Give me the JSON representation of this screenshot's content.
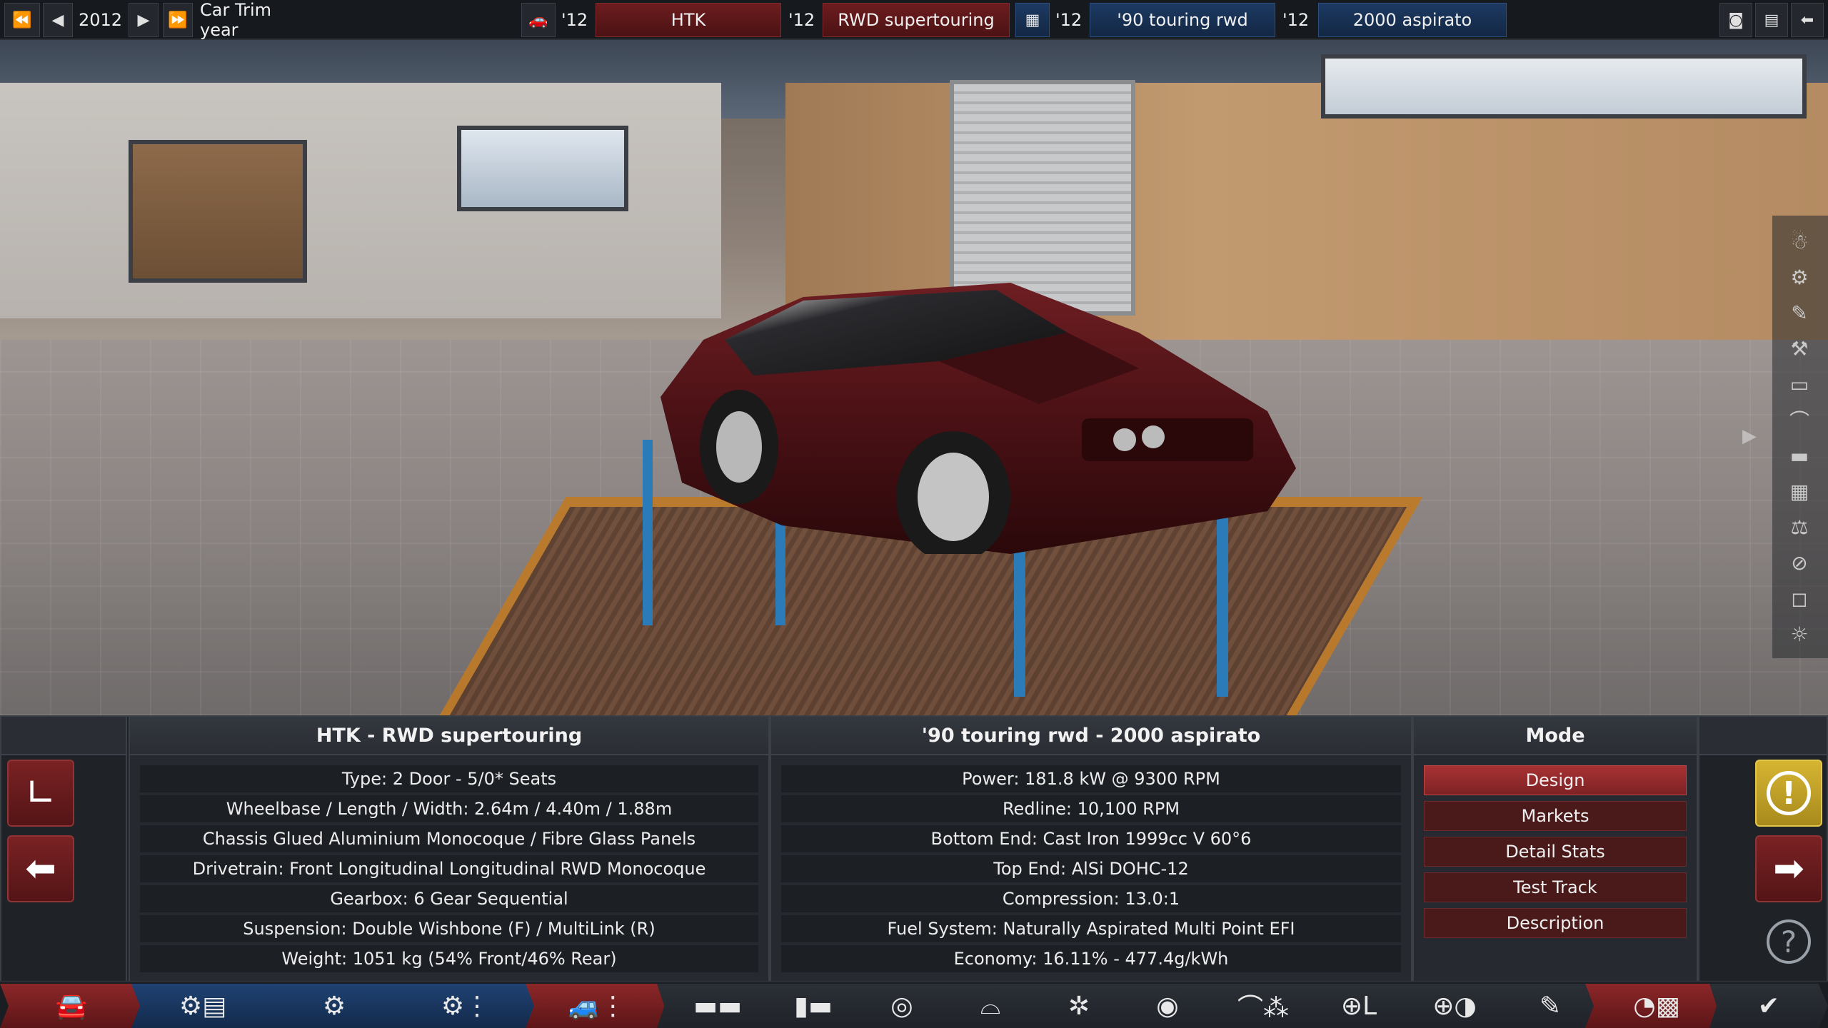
{
  "topbar": {
    "year": "2012",
    "year_label": "Car Trim year",
    "model_year": "'12",
    "model_name": "HTK",
    "trim_year": "'12",
    "trim_name": "RWD supertouring",
    "engine_family_year": "'12",
    "engine_family": "'90 touring rwd",
    "engine_variant_year": "'12",
    "engine_variant": "2000 aspirato"
  },
  "car_panel": {
    "title": "HTK - RWD supertouring",
    "rows": [
      "Type: 2 Door - 5/0* Seats",
      "Wheelbase / Length / Width: 2.64m / 4.40m / 1.88m",
      "Chassis Glued Aluminium Monocoque / Fibre Glass Panels",
      "Drivetrain: Front Longitudinal Longitudinal RWD Monocoque",
      "Gearbox: 6 Gear Sequential",
      "Suspension: Double Wishbone (F) / MultiLink (R)",
      "Weight: 1051 kg (54% Front/46% Rear)"
    ]
  },
  "engine_panel": {
    "title": "'90 touring rwd - 2000 aspirato",
    "rows": [
      "Power: 181.8 kW @ 9300 RPM",
      "Redline:  10,100 RPM",
      "Bottom End: Cast Iron 1999cc V 60°6",
      "Top End: AlSi DOHC-12",
      "Compression: 13.0:1",
      "Fuel System: Naturally Aspirated Multi Point EFI",
      "Economy: 16.11% - 477.4g/kWh"
    ]
  },
  "mode_panel": {
    "title": "Mode",
    "buttons": [
      "Design",
      "Markets",
      "Detail Stats",
      "Test Track",
      "Description"
    ],
    "active": "Design"
  },
  "icons": {
    "rewind": "⏪",
    "prev": "◀",
    "next": "▶",
    "forward": "⏩",
    "back": "⬅",
    "camera": "📷",
    "warning": "!",
    "help": "?",
    "arrow_right": "➡",
    "checkmark": "✔"
  },
  "colors": {
    "accent_red": "#a83234",
    "accent_blue": "#1d3a63",
    "warning_yellow": "#d6b533"
  }
}
